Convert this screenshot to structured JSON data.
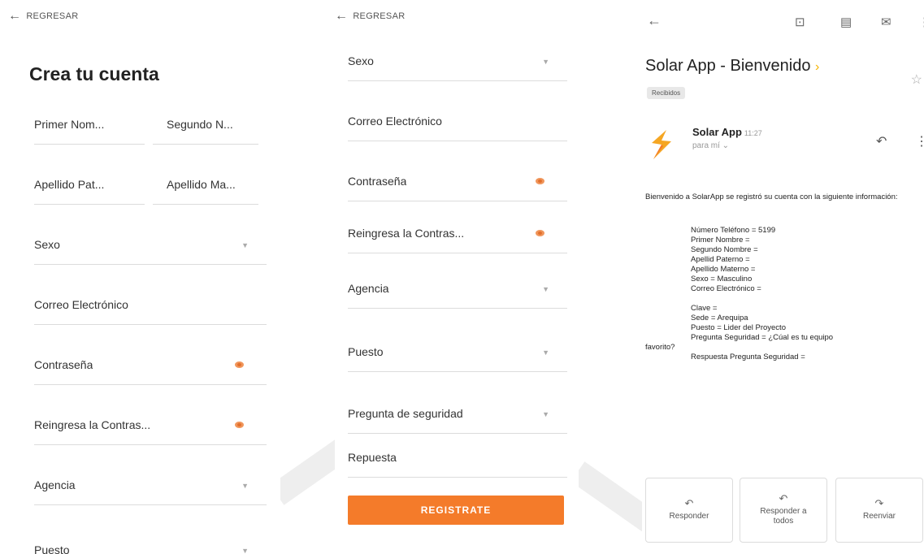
{
  "colors": {
    "accent": "#f47b2a",
    "eye": "#e26f2c",
    "chevron": "#f5b400"
  },
  "signup": {
    "back_label": "REGRESAR",
    "title": "Crea tu cuenta",
    "fields": {
      "first_name": "Primer Nom...",
      "second_name": "Segundo N...",
      "last_name_p": "Apellido Pat...",
      "last_name_m": "Apellido Ma...",
      "sex": "Sexo",
      "email": "Correo Electrónico",
      "password": "Contraseña",
      "password_confirm": "Reingresa la Contras...",
      "agency": "Agencia",
      "position": "Puesto"
    }
  },
  "signup_scrolled": {
    "back_label": "REGRESAR",
    "fields": {
      "sex": "Sexo",
      "email": "Correo Electrónico",
      "password": "Contraseña",
      "password_confirm": "Reingresa la Contras...",
      "agency": "Agencia",
      "position": "Puesto",
      "security_question": "Pregunta de seguridad",
      "answer": "Repuesta"
    },
    "register_button": "REGISTRATE"
  },
  "email": {
    "icons": [
      "back-arrow-icon",
      "archive-icon",
      "delete-icon",
      "mail-icon",
      "more-icon"
    ],
    "subject": "Solar App - Bienvenido",
    "subject_marker": "›",
    "label_badge": "Recibidos",
    "sender": "Solar App",
    "time": "11:27",
    "to": "para mí ⌄",
    "intro": "Bienvenido a SolarApp se registró su cuenta con la siguiente información:",
    "info_lines": [
      "Número Teléfono = 5199",
      "Primer Nombre =",
      "Segundo Nombre =",
      "Apellid Paterno =",
      "Apellido Materno =",
      "Sexo = Masculino",
      "Correo Electrónico ="
    ],
    "info_lines_2": [
      "Clave =",
      "Sede = Arequipa",
      "Puesto = Lider del Proyecto",
      "Pregunta Seguridad = ¿Cúal es tu equipo"
    ],
    "info_wrap": "favorito?",
    "info_last": "Respuesta Pregunta Seguridad =",
    "actions": {
      "reply": "Responder",
      "reply_all": "Responder a todos",
      "forward": "Reenviar"
    }
  }
}
